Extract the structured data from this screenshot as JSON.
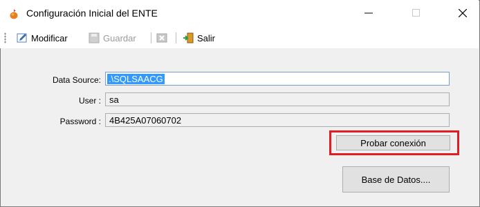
{
  "window": {
    "title": "Configuración Inicial del ENTE"
  },
  "toolbar": {
    "modificar": "Modificar",
    "guardar": "Guardar",
    "salir": "Salir"
  },
  "form": {
    "data_source_label": "Data Source:",
    "data_source_value": ".\\SQLSAACG",
    "user_label": "User :",
    "user_value": "sa",
    "password_label": "Password :",
    "password_value": "4B425A07060702"
  },
  "buttons": {
    "probar": "Probar conexión",
    "base_datos": "Base de Datos...."
  },
  "colors": {
    "highlight": "#e31b23",
    "selection": "#3399ff"
  }
}
